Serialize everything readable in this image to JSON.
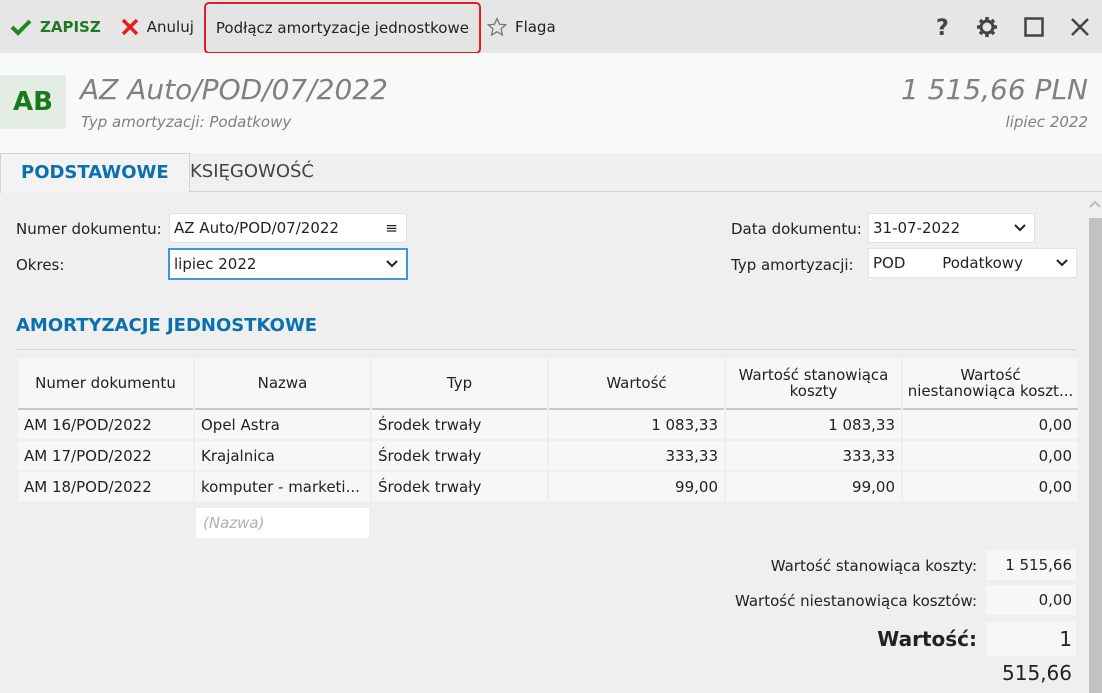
{
  "toolbar": {
    "save": "ZAPISZ",
    "cancel": "Anuluj",
    "attach": "Podłącz amortyzacje jednostkowe",
    "flag": "Flaga"
  },
  "header": {
    "avatar": "AB",
    "title": "AZ Auto/POD/07/2022",
    "subtitle": "Typ amortyzacji: Podatkowy",
    "amount": "1 515,66 PLN",
    "period": "lipiec 2022"
  },
  "tabs": [
    "PODSTAWOWE",
    "KSIĘGOWOŚĆ"
  ],
  "form": {
    "doc_number_label": "Numer dokumentu:",
    "doc_number": "AZ Auto/POD/07/2022",
    "period_label": "Okres:",
    "period": "lipiec 2022",
    "date_label": "Data dokumentu:",
    "date": "31-07-2022",
    "type_label": "Typ amortyzacji:",
    "type_code": "POD",
    "type_name": "Podatkowy"
  },
  "section": "AMORTYZACJE JEDNOSTKOWE",
  "table": {
    "headers": [
      "Numer dokumentu",
      "Nazwa",
      "Typ",
      "Wartość",
      "Wartość stanowiąca koszty",
      "Wartość niestanowiąca koszt..."
    ],
    "rows": [
      [
        "AM 16/POD/2022",
        "Opel Astra",
        "Środek trwały",
        "1 083,33",
        "1 083,33",
        "0,00"
      ],
      [
        "AM 17/POD/2022",
        "Krajalnica",
        "Środek trwały",
        "333,33",
        "333,33",
        "0,00"
      ],
      [
        "AM 18/POD/2022",
        "komputer - marketi...",
        "Środek trwały",
        "99,00",
        "99,00",
        "0,00"
      ]
    ],
    "new_placeholder": "(Nazwa)"
  },
  "summary": {
    "cost_label": "Wartość stanowiąca koszty:",
    "cost": "1 515,66",
    "noncost_label": "Wartość niestanowiąca kosztów:",
    "noncost": "0,00",
    "total_label": "Wartość:",
    "total": "1 515,66"
  }
}
